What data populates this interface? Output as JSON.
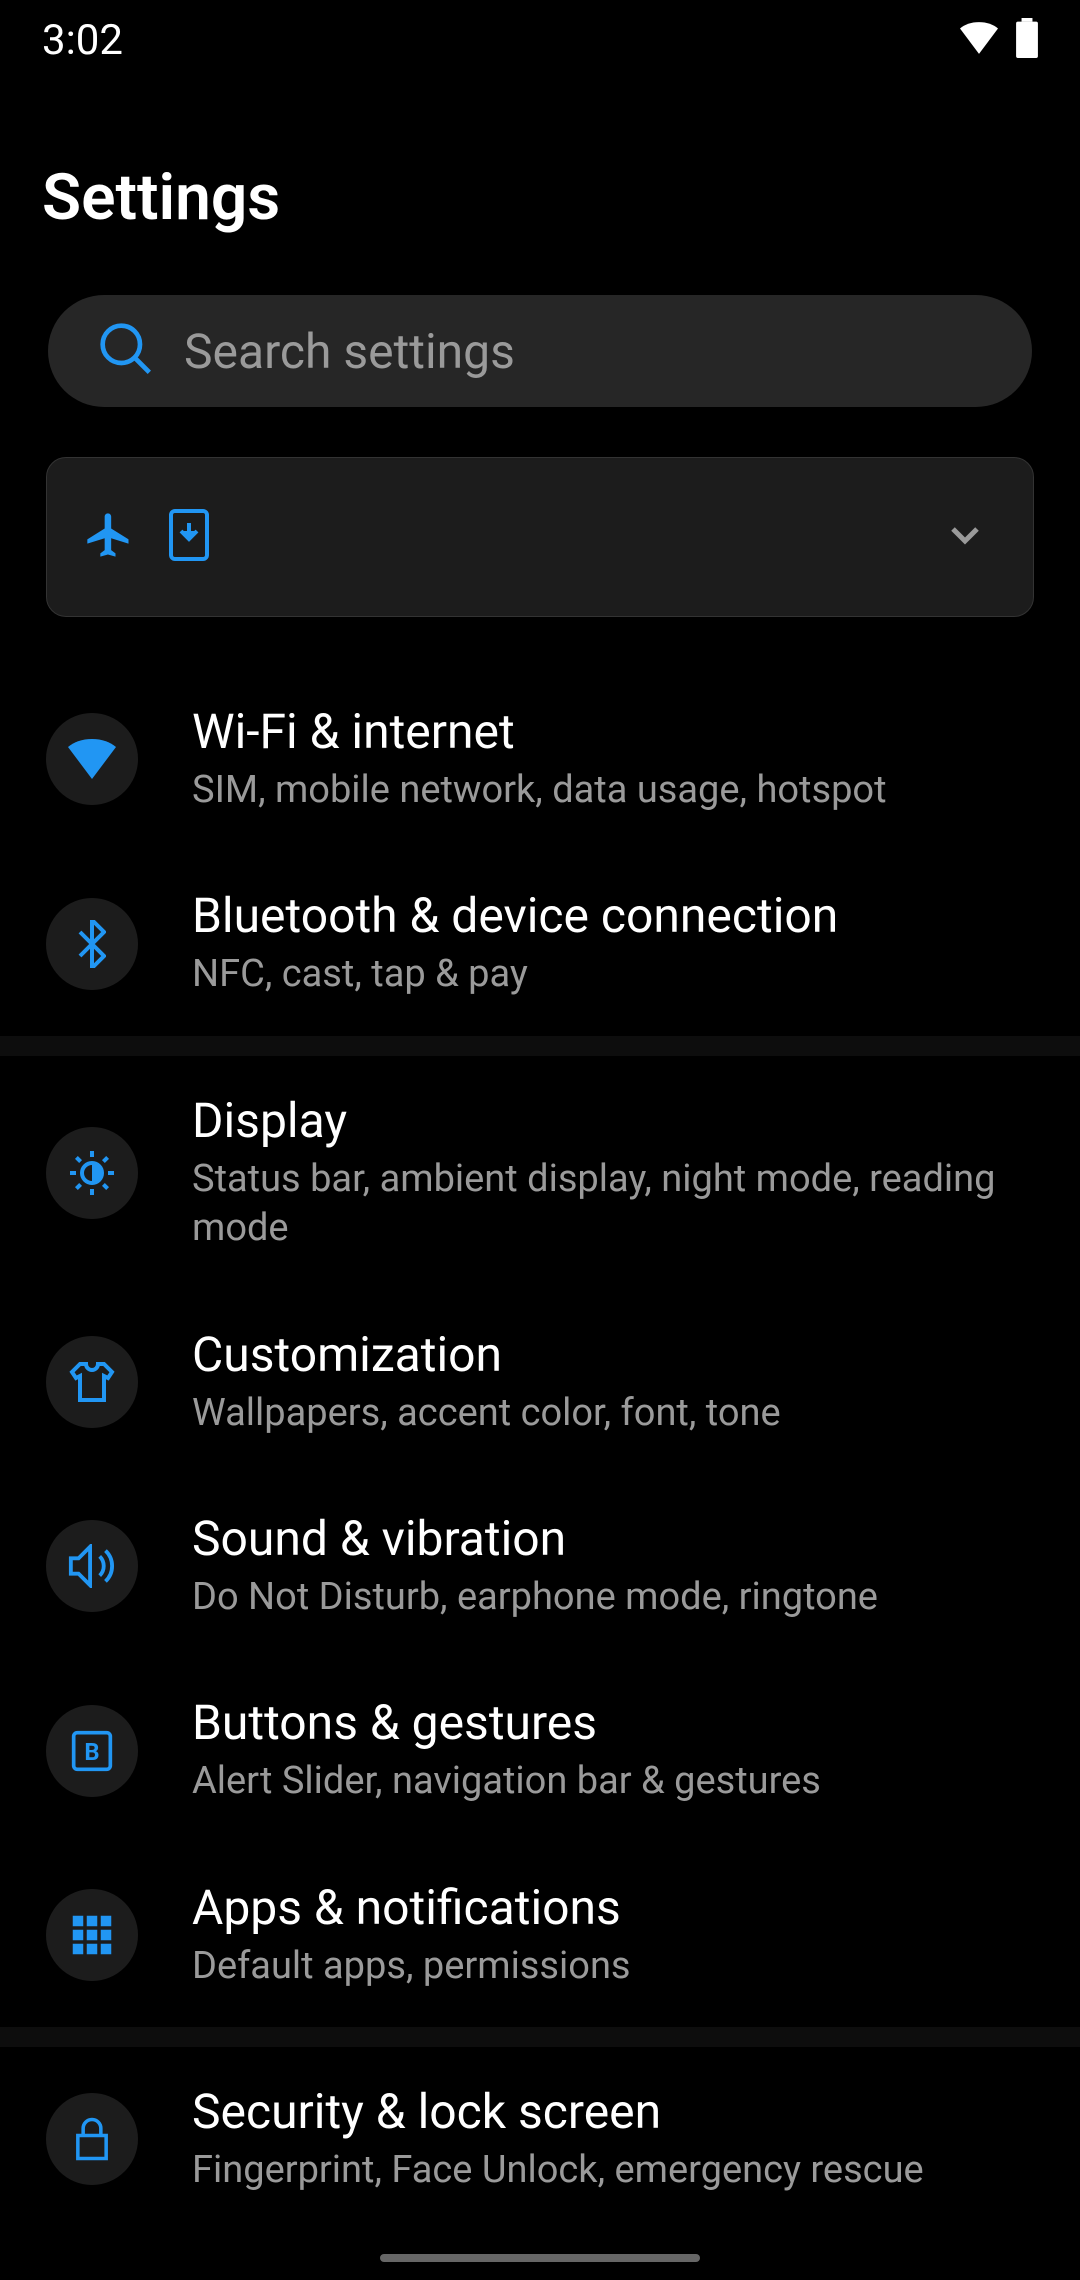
{
  "status": {
    "time": "3:02"
  },
  "header": {
    "title": "Settings"
  },
  "search": {
    "placeholder": "Search settings"
  },
  "colors": {
    "accent": "#2196f3",
    "accentLight": "#42a5f5"
  },
  "items": [
    {
      "title": "Wi-Fi & internet",
      "subtitle": "SIM, mobile network, data usage, hotspot"
    },
    {
      "title": "Bluetooth & device connection",
      "subtitle": "NFC, cast, tap & pay"
    },
    {
      "title": "Display",
      "subtitle": "Status bar, ambient display, night mode, reading mode"
    },
    {
      "title": "Customization",
      "subtitle": "Wallpapers, accent color, font, tone"
    },
    {
      "title": "Sound & vibration",
      "subtitle": "Do Not Disturb, earphone mode, ringtone"
    },
    {
      "title": "Buttons & gestures",
      "subtitle": "Alert Slider, navigation bar & gestures"
    },
    {
      "title": "Apps & notifications",
      "subtitle": "Default apps, permissions"
    },
    {
      "title": "Security & lock screen",
      "subtitle": "Fingerprint, Face Unlock, emergency rescue"
    }
  ]
}
